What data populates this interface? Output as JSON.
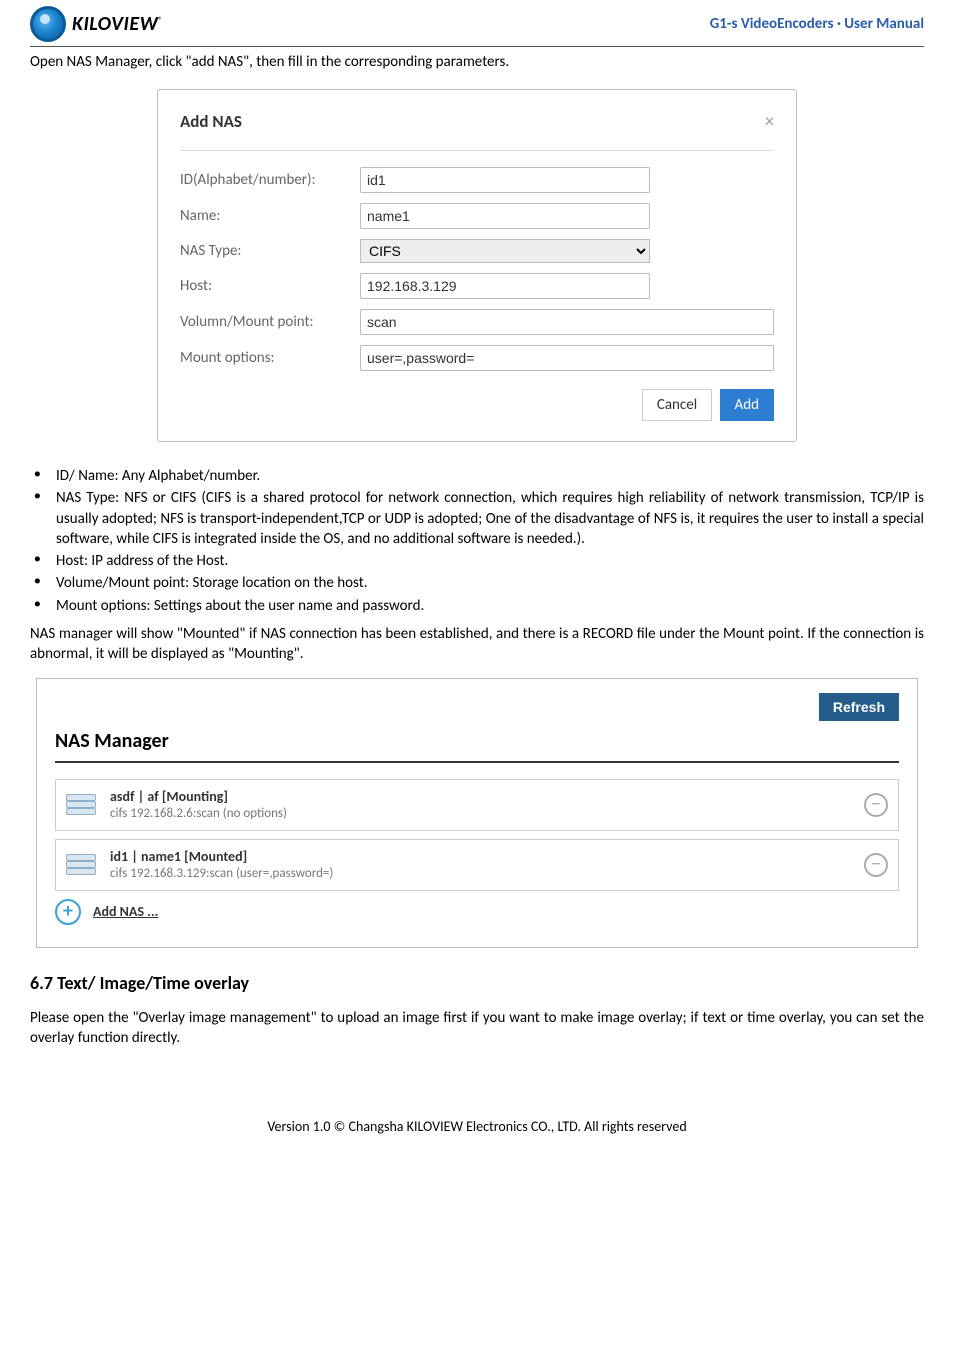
{
  "header": {
    "brand": "KILOVIEW",
    "brand_reg": "®",
    "doc_title": "G1-s VideoEncoders · User Manual"
  },
  "intro": "Open NAS Manager, click \"add NAS\", then fill in the corresponding parameters.",
  "dialog": {
    "title": "Add NAS",
    "close": "×",
    "fields": {
      "id_label": "ID(Alphabet/number):",
      "id_value": "id1",
      "name_label": "Name:",
      "name_value": "name1",
      "type_label": "NAS Type:",
      "type_value": "CIFS",
      "host_label": "Host:",
      "host_value": "192.168.3.129",
      "mount_label": "Volumn/Mount point:",
      "mount_value": "scan",
      "opts_label": "Mount options:",
      "opts_value": "user=,password="
    },
    "cancel": "Cancel",
    "add": "Add"
  },
  "bullets": [
    "ID/ Name: Any Alphabet/number.",
    "NAS Type: NFS or CIFS (CIFS is a shared protocol for network connection, which requires high reliability of network transmission, TCP/IP is usually adopted; NFS is transport-independent,TCP or UDP is adopted; One of the disadvantage of NFS is, it requires the user to install a special software, while CIFS is integrated inside the OS, and no additional software is needed.).",
    "Host: IP address of the Host.",
    "Volume/Mount point: Storage location on the host.",
    "Mount options: Settings about the user name and password."
  ],
  "post_bullets": "NAS manager will show \"Mounted\" if NAS connection has been established, and there is a RECORD file under the Mount point. If the connection is abnormal, it will be displayed as \"Mounting\".",
  "panel": {
    "refresh": "Refresh",
    "title": "NAS Manager",
    "rows": [
      {
        "line1": "asdf | af [Mounting]",
        "line2": "cifs 192.168.2.6:scan (no options)"
      },
      {
        "line1": "id1 | name1 [Mounted]",
        "line2": "cifs 192.168.3.129:scan (user=,password=)"
      }
    ],
    "add_link": "Add NAS ..."
  },
  "section_heading": "6.7 Text/ Image/Time overlay",
  "section_body": "Please open the \"Overlay image management\" to upload an image first if you want to make image overlay; if text or time overlay, you can set the overlay function directly.",
  "footer": "Version 1.0 © Changsha KILOVIEW Electronics CO., LTD. All rights reserved"
}
